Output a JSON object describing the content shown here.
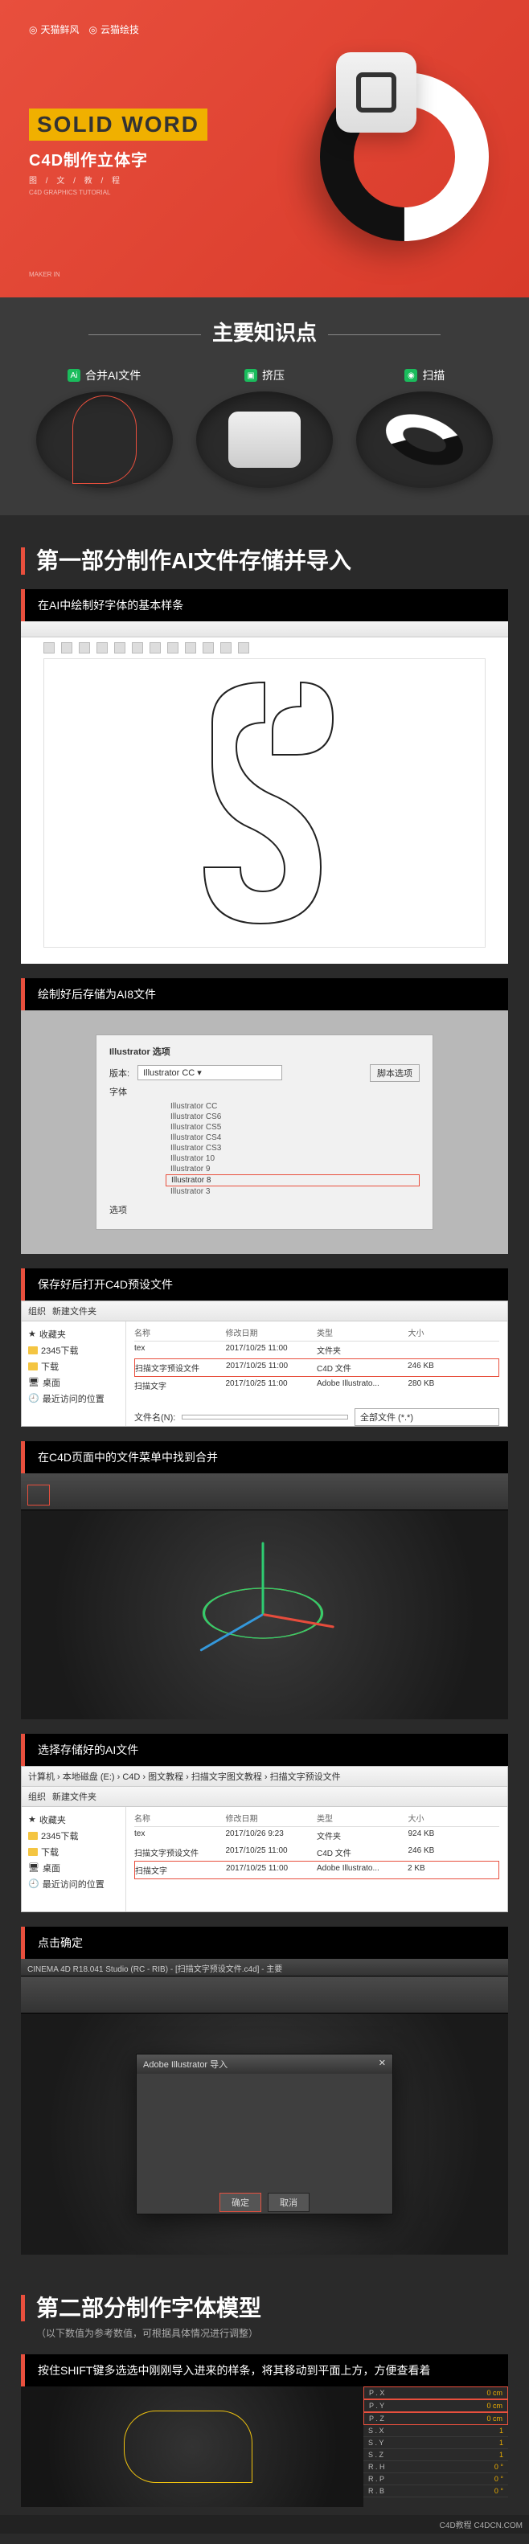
{
  "hero": {
    "logo1": "天猫鲜风",
    "logo2": "云猫绘技",
    "title": "SOLID WORD",
    "subtitle": "C4D制作立体字",
    "meta": "图 / 文 / 教 / 程",
    "meta2": "C4D GRAPHICS TUTORIAL",
    "maker": "MAKER IN"
  },
  "knowledge": {
    "title": "主要知识点",
    "items": [
      {
        "label": "合并AI文件"
      },
      {
        "label": "挤压"
      },
      {
        "label": "扫描"
      }
    ]
  },
  "part1": {
    "heading": "第一部分制作AI文件存储并导入",
    "steps": [
      {
        "bar": "在AI中绘制好字体的基本样条"
      },
      {
        "bar": "绘制好后存储为AI8文件"
      },
      {
        "bar": "保存好后打开C4D预设文件"
      },
      {
        "bar": "在C4D页面中的文件菜单中找到合并"
      },
      {
        "bar": "选择存储好的AI文件"
      },
      {
        "bar": "点击确定"
      }
    ]
  },
  "ai_save_dialog": {
    "title": "Illustrator 选项",
    "version_label": "版本:",
    "version_value": "Illustrator CC",
    "fonts_label": "字体",
    "script_btn": "脚本选项",
    "versions": [
      "Illustrator CC",
      "Illustrator CS6",
      "Illustrator CS5",
      "Illustrator CS4",
      "Illustrator CS3",
      "Illustrator 10",
      "Illustrator 9",
      "Illustrator 8",
      "Illustrator 3"
    ],
    "highlighted": "Illustrator 8",
    "options_label": "选项"
  },
  "explorer": {
    "nav": [
      "组织",
      "新建文件夹"
    ],
    "side": [
      "收藏夹",
      "2345下载",
      "下载",
      "桌面",
      "最近访问的位置"
    ],
    "cols": [
      "名称",
      "修改日期",
      "类型",
      "大小"
    ],
    "rows": [
      {
        "name": "tex",
        "date": "2017/10/25 11:00",
        "type": "文件夹",
        "size": ""
      },
      {
        "name": "扫描文字预设文件",
        "date": "2017/10/25 11:00",
        "type": "C4D 文件",
        "size": "246 KB",
        "hl": true
      },
      {
        "name": "扫描文字",
        "date": "2017/10/25 11:00",
        "type": "Adobe Illustrato...",
        "size": "280 KB"
      }
    ],
    "filename_label": "文件名(N):",
    "filter": "全部文件 (*.*)"
  },
  "explorer2": {
    "breadcrumbs": "计算机 › 本地磁盘 (E:) › C4D › 图文教程 › 扫描文字图文教程 › 扫描文字预设文件",
    "side": [
      "收藏夹",
      "2345下载",
      "下载",
      "桌面",
      "最近访问的位置"
    ],
    "cols": [
      "名称",
      "修改日期",
      "类型",
      "大小"
    ],
    "rows": [
      {
        "name": "tex",
        "date": "2017/10/26 9:23",
        "type": "文件夹",
        "size": "924 KB"
      },
      {
        "name": "扫描文字预设文件",
        "date": "2017/10/25 11:00",
        "type": "C4D 文件",
        "size": "246 KB"
      },
      {
        "name": "扫描文字",
        "date": "2017/10/25 11:00",
        "type": "Adobe Illustrato...",
        "size": "2 KB",
        "hl": true
      }
    ]
  },
  "c4d_dialog": {
    "title": "Adobe Illustrator 导入",
    "ok": "确定",
    "cancel": "取消"
  },
  "c4d_titlebar": "CINEMA 4D R18.041 Studio (RC - RIB) - [扫描文字预设文件.c4d] - 主要",
  "part2": {
    "heading": "第二部分制作字体模型",
    "note": "（以下数值为参考数值，可根据具体情况进行调整）",
    "step1": "按住SHIFT键多选选中刚刚导入进来的样条，将其移动到平面上方，方便查看着"
  },
  "panel_rows": [
    {
      "k": "P . X",
      "v": "0 cm"
    },
    {
      "k": "P . Y",
      "v": "0 cm"
    },
    {
      "k": "P . Z",
      "v": "0 cm"
    },
    {
      "k": "S . X",
      "v": "1"
    },
    {
      "k": "S . Y",
      "v": "1"
    },
    {
      "k": "S . Z",
      "v": "1"
    },
    {
      "k": "R . H",
      "v": "0 °"
    },
    {
      "k": "R . P",
      "v": "0 °"
    },
    {
      "k": "R . B",
      "v": "0 °"
    }
  ],
  "watermark": "C4D教程 C4DCN.COM"
}
